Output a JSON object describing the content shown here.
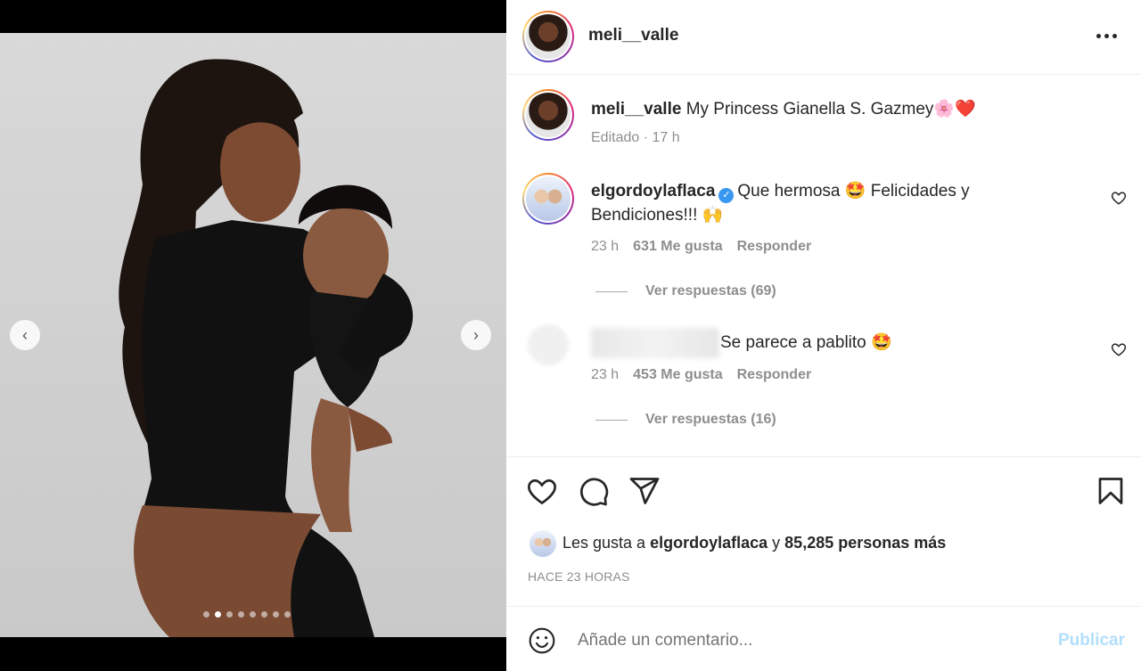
{
  "post": {
    "username": "meli__valle",
    "carousel": {
      "total": 8,
      "active_index": 1
    }
  },
  "caption": {
    "username": "meli__valle",
    "text": "My Princess Gianella S. Gazmey🌸❤️",
    "meta": "Editado · 17 h"
  },
  "comments": [
    {
      "username": "elgordoylaflaca",
      "verified": true,
      "text": "Que hermosa 🤩 Felicidades y Bendiciones!!! 🙌",
      "time": "23 h",
      "likes": "631 Me gusta",
      "reply_label": "Responder",
      "view_replies": "Ver respuestas (69)"
    },
    {
      "username": "",
      "text": "Se parece a pablito 🤩",
      "time": "23 h",
      "likes": "453 Me gusta",
      "reply_label": "Responder",
      "view_replies": "Ver respuestas (16)"
    }
  ],
  "likes_summary": {
    "prefix": "Les gusta a",
    "user": "elgordoylaflaca",
    "connector": "y",
    "others": "85,285 personas más"
  },
  "timestamp": "HACE 23 HORAS",
  "comment_box": {
    "placeholder": "Añade un comentario...",
    "publish_label": "Publicar"
  },
  "colors": {
    "text": "#262626",
    "muted": "#8e8e8e",
    "publish_disabled": "#b2dffc",
    "verified": "#3897f0"
  },
  "icons": [
    "heart-icon",
    "comment-icon",
    "share-icon",
    "bookmark-icon",
    "emoji-icon",
    "more-icon",
    "chevron-left-icon",
    "chevron-right-icon"
  ]
}
